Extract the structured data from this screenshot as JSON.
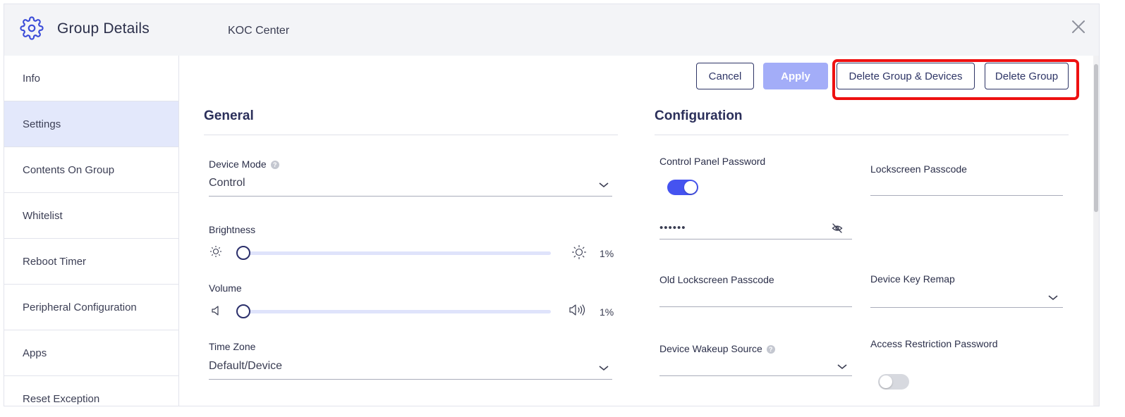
{
  "header": {
    "title": "Group Details",
    "group_name": "KOC Center",
    "icon": "gear-icon",
    "close_icon": "close-icon"
  },
  "sidebar": {
    "items": [
      {
        "label": "Info",
        "active": false
      },
      {
        "label": "Settings",
        "active": true
      },
      {
        "label": "Contents On Group",
        "active": false
      },
      {
        "label": "Whitelist",
        "active": false
      },
      {
        "label": "Reboot Timer",
        "active": false
      },
      {
        "label": "Peripheral Configuration",
        "active": false
      },
      {
        "label": "Apps",
        "active": false
      },
      {
        "label": "Reset Exception",
        "active": false
      }
    ]
  },
  "actions": {
    "cancel": "Cancel",
    "apply": "Apply",
    "delete_group_devices": "Delete Group & Devices",
    "delete_group": "Delete Group"
  },
  "general": {
    "title": "General",
    "device_mode": {
      "label": "Device Mode",
      "value": "Control"
    },
    "brightness": {
      "label": "Brightness",
      "value_text": "1%",
      "level": 0.01
    },
    "volume": {
      "label": "Volume",
      "value_text": "1%",
      "level": 0.01
    },
    "time_zone": {
      "label": "Time Zone",
      "value": "Default/Device"
    }
  },
  "configuration": {
    "title": "Configuration",
    "control_panel_password": {
      "label": "Control Panel Password",
      "enabled": true,
      "value": "••••••"
    },
    "lockscreen_passcode": {
      "label": "Lockscreen Passcode",
      "value": ""
    },
    "old_lockscreen_passcode": {
      "label": "Old Lockscreen Passcode",
      "value": ""
    },
    "device_key_remap": {
      "label": "Device Key Remap",
      "value": ""
    },
    "device_wakeup_source": {
      "label": "Device Wakeup Source",
      "value": ""
    },
    "access_restriction_password": {
      "label": "Access Restriction Password",
      "enabled": false
    }
  },
  "colors": {
    "accent": "#4553f0",
    "apply_disabled": "#a3adf8",
    "highlight": "#ee1111",
    "active_nav": "#e3e8fb"
  }
}
